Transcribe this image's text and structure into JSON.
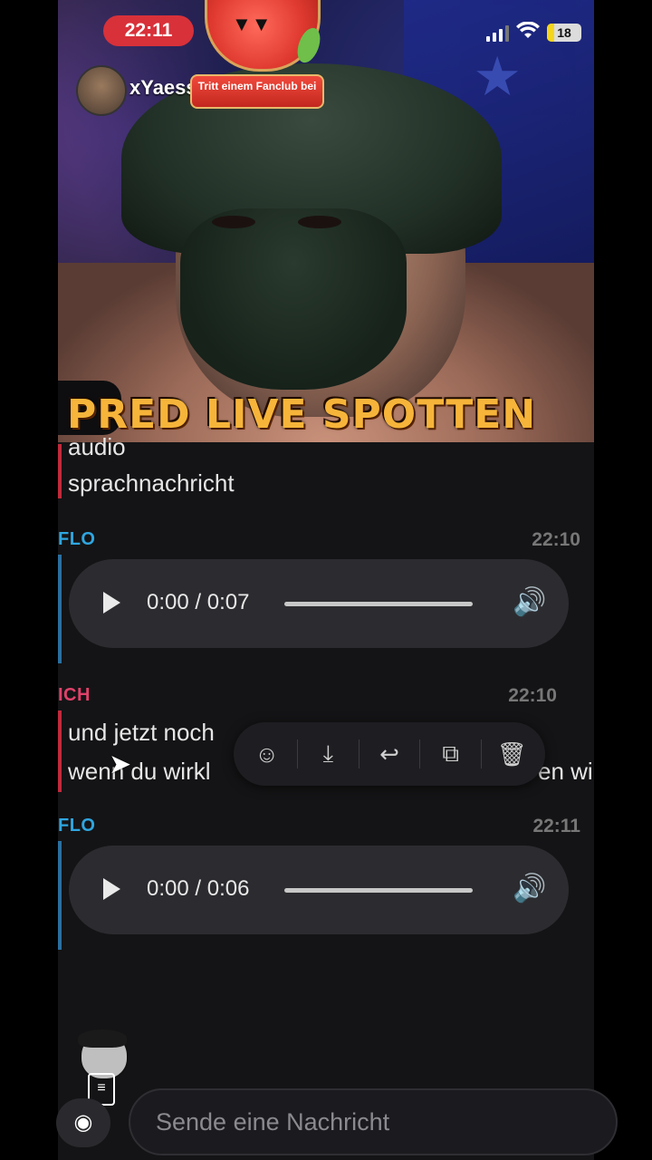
{
  "status_bar": {
    "time": "22:11",
    "battery": "18"
  },
  "stream": {
    "username": "xYaessin",
    "promo_text": "Tritt einem Fanclub bei",
    "title": "PRED LIVE SPOTTEN"
  },
  "chat": {
    "partial_lines": [
      "audio",
      "sprachnachricht"
    ],
    "messages": [
      {
        "sender": "FLO",
        "time": "22:10",
        "audio_time": "0:00 / 0:07"
      },
      {
        "sender": "ICH",
        "time": "22:10",
        "line1": "und jetzt noch",
        "line2": "wenn du wirkl",
        "line2_tail": "en wi"
      },
      {
        "sender": "FLO",
        "time": "22:11",
        "audio_time": "0:00 / 0:06"
      }
    ]
  },
  "context_menu": {
    "icons": [
      "emoji-reaction-icon",
      "save-icon",
      "reply-icon",
      "copy-icon",
      "delete-icon"
    ]
  },
  "composer": {
    "placeholder": "Sende eine Nachricht"
  },
  "colors": {
    "flo": "#2fa6e0",
    "ich": "#e0416a",
    "live_badge": "#d8313a"
  }
}
